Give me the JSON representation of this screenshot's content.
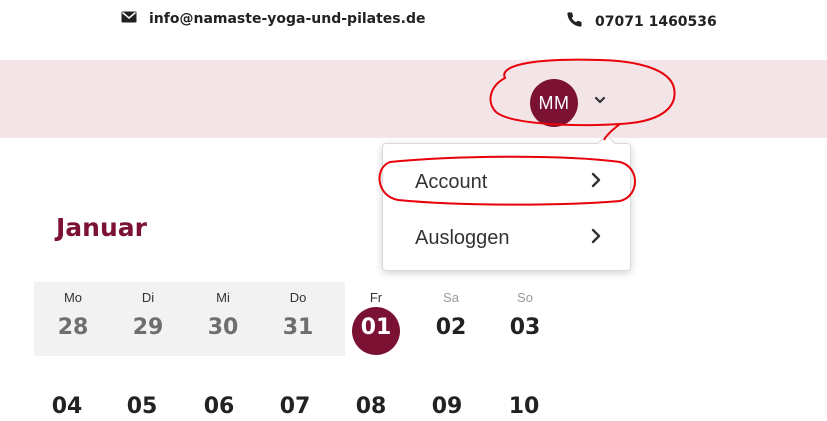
{
  "contact": {
    "email": "info@namaste-yoga-und-pilates.de",
    "phone": "07071 1460536"
  },
  "user_menu": {
    "initials": "MM",
    "items": [
      {
        "label": "Account"
      },
      {
        "label": "Ausloggen"
      }
    ]
  },
  "calendar": {
    "month": "Januar",
    "weekdays": [
      "Mo",
      "Di",
      "Mi",
      "Do",
      "Fr",
      "Sa",
      "So"
    ],
    "week1": [
      "28",
      "29",
      "30",
      "31",
      "01",
      "02",
      "03"
    ],
    "week2": [
      "04",
      "05",
      "06",
      "07",
      "08",
      "09",
      "10"
    ],
    "selected_day": "01"
  },
  "colors": {
    "brand": "#7b1234",
    "header_bg": "#f2e4e7",
    "annotation": "#e8000b"
  }
}
